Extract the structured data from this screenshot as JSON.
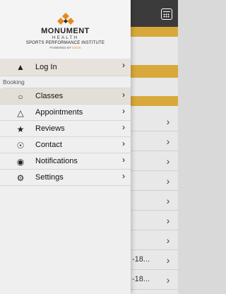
{
  "brand": {
    "name": "MONUMENT",
    "sub": "HEALTH",
    "tagline": "SPORTS PERFORMANCE INSTITUTE",
    "powered_prefix": "POWERED BY",
    "powered_brand": "EXOS"
  },
  "menu": {
    "login": {
      "label": "Log In",
      "icon": "warning-icon"
    },
    "section_booking": "Booking",
    "items": [
      {
        "label": "Classes",
        "icon": "circle-icon"
      },
      {
        "label": "Appointments",
        "icon": "triangle-icon"
      },
      {
        "label": "Reviews",
        "icon": "star-icon"
      },
      {
        "label": "Contact",
        "icon": "location-pin-icon"
      },
      {
        "label": "Notifications",
        "icon": "bubble-icon"
      },
      {
        "label": "Settings",
        "icon": "gear-icon"
      }
    ]
  },
  "background": {
    "rows": [
      {
        "text": ""
      },
      {
        "text": ""
      },
      {
        "text": ""
      },
      {
        "text": ""
      },
      {
        "text": ""
      },
      {
        "text": ""
      },
      {
        "text": ""
      },
      {
        "text": "-18..."
      },
      {
        "text": "-18..."
      }
    ]
  },
  "colors": {
    "accent_bar": "#d8a93a",
    "drawer_bg": "#efefef",
    "powered_accent": "#e58a1b",
    "logo_orange": "#e58a1b"
  }
}
